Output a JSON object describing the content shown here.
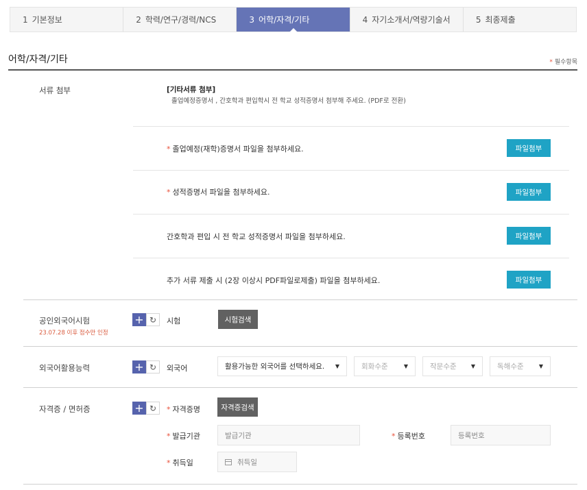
{
  "steps": [
    {
      "num": "1",
      "label": "기본정보",
      "active": false
    },
    {
      "num": "2",
      "label": "학력/연구/경력/NCS",
      "active": false
    },
    {
      "num": "3",
      "label": "어학/자격/기타",
      "active": true
    },
    {
      "num": "4",
      "label": "자기소개서/역량기술서",
      "active": false
    },
    {
      "num": "5",
      "label": "최종제출",
      "active": false
    }
  ],
  "section": {
    "title": "어학/자격/기타",
    "required_note": "필수항목",
    "star": "*"
  },
  "documents": {
    "label": "서류 첨부",
    "desc_title": "[기타서류 첨부]",
    "desc_body": "졸업예정증명서 , 간호학과 편입학시 전 학교 성적증명서 첨부해 주세요. (PDF로 전환)",
    "items": [
      {
        "text": "졸업예정(재학)증명서 파일을 첨부하세요.",
        "required": true,
        "button": "파일첨부"
      },
      {
        "text": "성적증명서 파일을 첨부하세요.",
        "required": true,
        "button": "파일첨부"
      },
      {
        "text": "간호학과 편입 시 전 학교 성적증명서 파일을 첨부하세요.",
        "required": false,
        "button": "파일첨부"
      },
      {
        "text": "추가 서류 제출 시 (2장 이상시 PDF파일로제출) 파일을 첨부하세요.",
        "required": false,
        "button": "파일첨부"
      }
    ]
  },
  "exam": {
    "label": "공인외국어시험",
    "note": "23.07.28 이후 점수만 인정",
    "field_label": "시험",
    "button": "시험검색"
  },
  "language": {
    "label": "외국어활용능력",
    "field_label": "외국어",
    "select_language": "활용가능한 외국어를 선택하세요.",
    "select_speaking": "회화수준",
    "select_writing": "작문수준",
    "select_reading": "독해수준"
  },
  "license": {
    "label": "자격증 / 면허증",
    "name_label": "자격증명",
    "name_button": "자격증검색",
    "issuer_label": "발급기관",
    "issuer_placeholder": "발급기관",
    "regno_label": "등록번호",
    "regno_placeholder": "등록번호",
    "date_label": "취득일",
    "date_placeholder": "취득일"
  },
  "icons": {
    "plus": "+",
    "refresh": "↻",
    "caret": "▼"
  },
  "colors": {
    "active_tab": "#6574b6",
    "attach_button": "#1fa3c5",
    "required_star": "#e8503a",
    "search_button": "#616161"
  }
}
